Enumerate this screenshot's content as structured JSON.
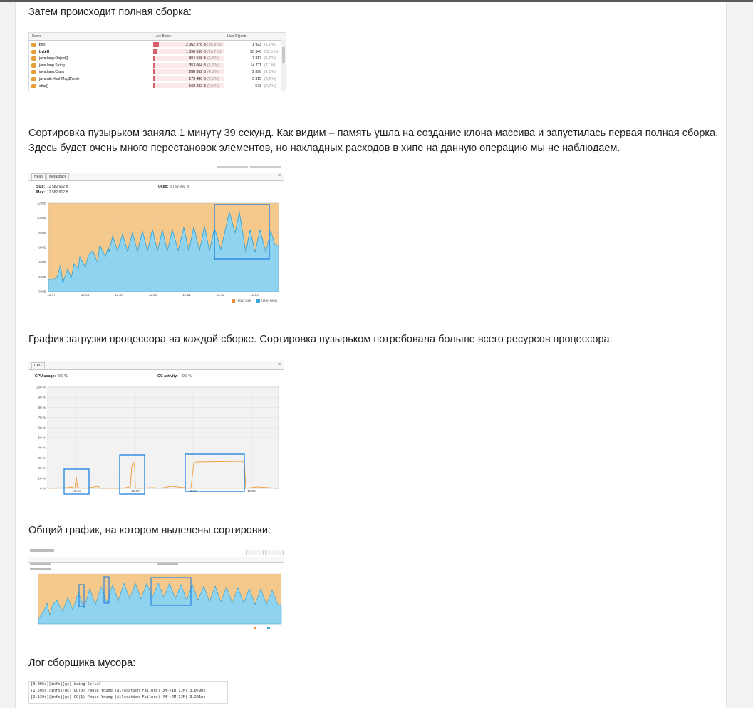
{
  "article": {
    "p_full_gc": "Затем происходит полная сборка:",
    "p_bubble": "Сортировка пузырьком заняла 1 минуту 39 секунд. Как видим – память ушла на создание клона массива и запустилась первая полная сборка.",
    "p_bubble_2": "Здесь будет очень много перестановок элементов, но накладных расходов в хипе на данную операцию мы не наблюдаем.",
    "p_cpu": "График загрузки процессора на каждой сборке. Сортировка пузырьком потребовала больше всего ресурсов процессора:",
    "p_overall": "Общий график, на котором выделены сортировки:",
    "p_log": "Лог сборщика мусора:"
  },
  "class_table": {
    "headers": [
      "Name",
      "Live Bytes",
      "Live Objects"
    ],
    "rows": [
      {
        "name": "int[]",
        "bytes": "2 062 376 B",
        "bytes_pct": "(36,4 %)",
        "objects": "1 923",
        "objects_pct": "(1,2 %)",
        "share": 0.364
      },
      {
        "name": "byte[]",
        "bytes": "1 396 056 B",
        "bytes_pct": "(20,7 %)",
        "objects": "35 946",
        "objects_pct": "(33,5 %)",
        "share": 0.207
      },
      {
        "name": "java.lang.Object[]",
        "bytes": "304 568 B",
        "bytes_pct": "(5,3 %)",
        "objects": "7 317",
        "objects_pct": "(6,7 %)",
        "share": 0.053
      },
      {
        "name": "java.lang.String",
        "bytes": "353 064 B",
        "bytes_pct": "(5,2 %)",
        "objects": "14 711",
        "objects_pct": "(17 %)",
        "share": 0.052
      },
      {
        "name": "java.lang.Class",
        "bytes": "288 352 B",
        "bytes_pct": "(4,3 %)",
        "objects": "2 396",
        "objects_pct": "(2,8 %)",
        "share": 0.043
      },
      {
        "name": "java.util.HashMap$Node",
        "bytes": "175 480 B",
        "bytes_pct": "(2,6 %)",
        "objects": "5 315",
        "objects_pct": "(6,4 %)",
        "share": 0.026
      },
      {
        "name": "char[]",
        "bytes": "169 232 B",
        "bytes_pct": "(2,5 %)",
        "objects": "573",
        "objects_pct": "(0,7 %)",
        "share": 0.025
      }
    ]
  },
  "heap_chart": {
    "tabs": [
      "Heap",
      "Metaspace"
    ],
    "size_label": "Size:",
    "size_value": "12 582 912 B",
    "max_label": "Max:",
    "max_value": "12 582 912 B",
    "used_label": "Used:",
    "used_value": "8 759 960 B",
    "y_ticks": [
      "12 MB",
      "10 MB",
      "8 MB",
      "6 MB",
      "4 MB",
      "2 MB",
      "0 MB"
    ],
    "x_ticks": [
      "12:47",
      "12:48",
      "12:49",
      "12:50",
      "12:51",
      "12:52",
      "12:53"
    ],
    "legend": [
      "Heap size",
      "Used heap"
    ],
    "colors": {
      "heap_size": "#f5c98b",
      "used_heap": "#8fd3ef",
      "highlight": "#1f7fe0"
    }
  },
  "cpu_chart": {
    "tab": "CPU",
    "cpu_label": "CPU usage:",
    "cpu_value": "0,0 %",
    "gc_label": "GC activity:",
    "gc_value": "0,0 %",
    "y_ticks": [
      "100 %",
      "90 %",
      "80 %",
      "70 %",
      "60 %",
      "50 %",
      "40 %",
      "30 %",
      "20 %",
      "10 %",
      "0 %"
    ],
    "x_ticks": [
      "12:48",
      "12:50",
      "12:52",
      "12:54"
    ],
    "colors": {
      "cpu": "#f0a040",
      "highlight": "#1f7fe0"
    }
  },
  "overview_chart": {
    "colors": {
      "heap_size": "#f5c98b",
      "used_heap": "#8fd3ef",
      "highlight": "#1f7fe0"
    }
  },
  "gc_log": {
    "lines": [
      "[0.006s][info][gc] Using Serial",
      "[1.605s][info][gc] GC(0) Pause Young (Allocation Failure) 3M->1M(11M) 3.079ms",
      "[2.139s][info][gc] GC(1) Pause Young (Allocation Failure) 4M->2M(11M) 3.201ms"
    ]
  }
}
